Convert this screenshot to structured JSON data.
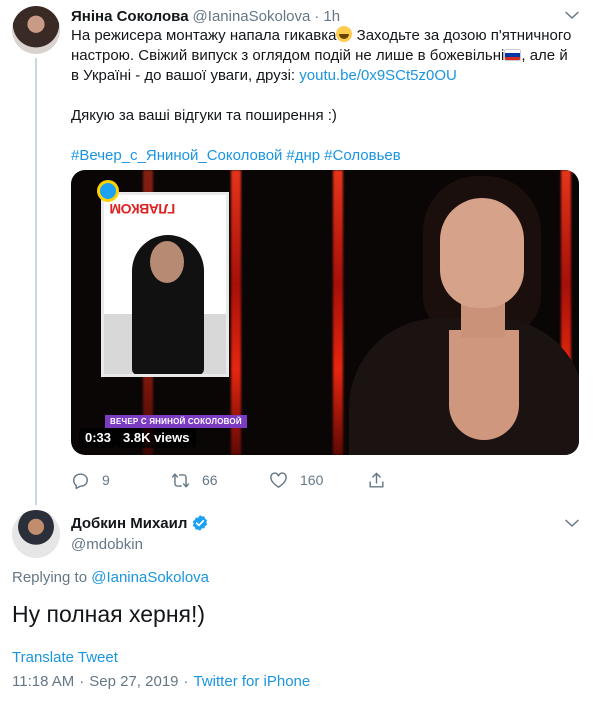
{
  "parent_tweet": {
    "author_name": "Яніна Соколова",
    "handle": "@IaninaSokolova",
    "separator": "·",
    "time": "1h",
    "text_line1_a": "На режисера монтажу напала гикавка",
    "text_line1_b": " Заходьте за дозою п'ятничного",
    "text_line2": "настрою. Свіжий випуск з оглядом подій не лише в божевільні",
    "text_line2_b": ", але й",
    "text_line3_a": "в Україні - до вашої уваги, друзі: ",
    "text_line3_link": "youtu.be/0x9SCt5z0OU",
    "text_line4": "Дякую за ваші відгуки та поширення :)",
    "hashtags": [
      "#Вечер_с_Яниной_Соколовой",
      "#днр",
      "#Соловьев"
    ],
    "emoji_icon": "face-with-tears-of-joy-emoji",
    "flag_icon": "russia-flag-emoji",
    "video": {
      "inset_brand": "ГЛАВКОМ",
      "lower_third": "ВЕЧЕР С ЯНИНОЙ СОКОЛОВОЙ",
      "duration": "0:33",
      "views": "3.8K views"
    },
    "actions": {
      "reply_count": "9",
      "retweet_count": "66",
      "like_count": "160",
      "reply_icon": "reply-icon",
      "retweet_icon": "retweet-icon",
      "like_icon": "heart-icon",
      "share_icon": "share-icon"
    }
  },
  "reply_tweet": {
    "author_name": "Добкин Михаил",
    "verified_icon": "verified-badge-icon",
    "handle": "@mdobkin",
    "replying_label": "Replying to ",
    "replying_to": "@IaninaSokolova",
    "text": "Ну полная херня!)",
    "translate_label": "Translate Tweet",
    "time": "11:18 AM",
    "date": "Sep 27, 2019",
    "separator": "·",
    "source": "Twitter for iPhone"
  },
  "colors": {
    "link_blue": "#1b95e0",
    "secondary_gray": "#657786",
    "text_dark": "#14171a",
    "verified_blue": "#1da1f2"
  }
}
